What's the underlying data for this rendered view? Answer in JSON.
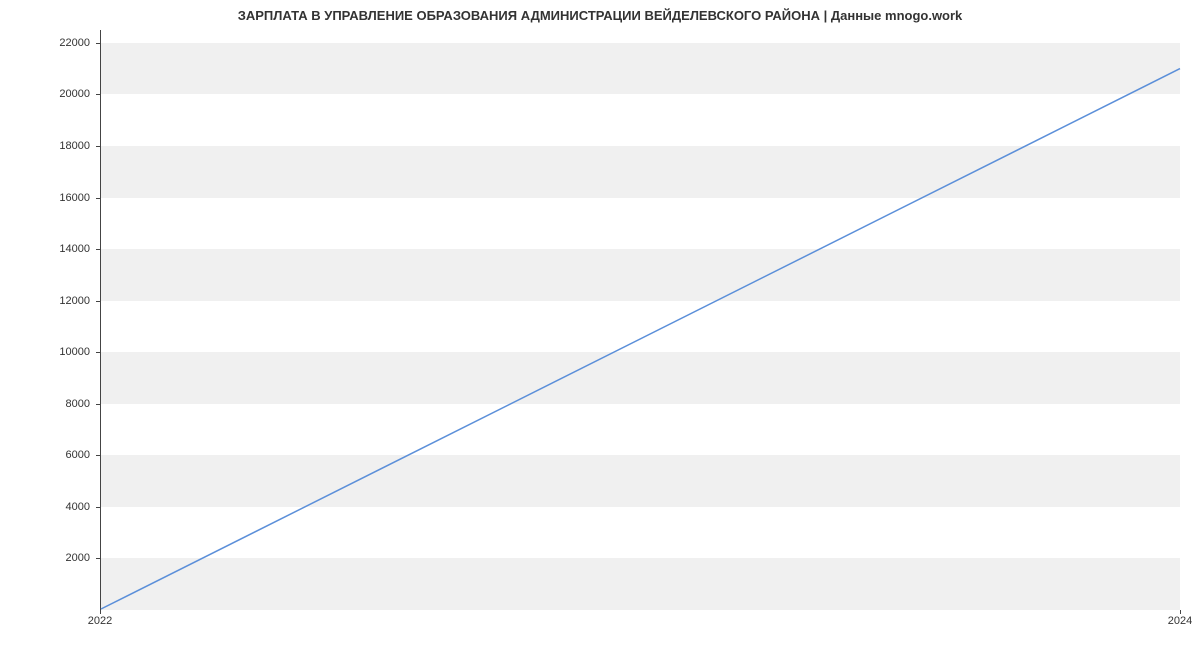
{
  "chart_data": {
    "type": "line",
    "title": "ЗАРПЛАТА В УПРАВЛЕНИЕ ОБРАЗОВАНИЯ АДМИНИСТРАЦИИ ВЕЙДЕЛЕВСКОГО РАЙОНА | Данные mnogo.work",
    "x": [
      2022,
      2024
    ],
    "values": [
      0,
      21000
    ],
    "xlabel": "",
    "ylabel": "",
    "x_ticks": [
      2022,
      2024
    ],
    "y_ticks": [
      2000,
      4000,
      6000,
      8000,
      10000,
      12000,
      14000,
      16000,
      18000,
      20000,
      22000
    ],
    "ylim": [
      0,
      22500
    ],
    "xlim": [
      2022,
      2024
    ],
    "line_color": "#5b8fd9"
  }
}
